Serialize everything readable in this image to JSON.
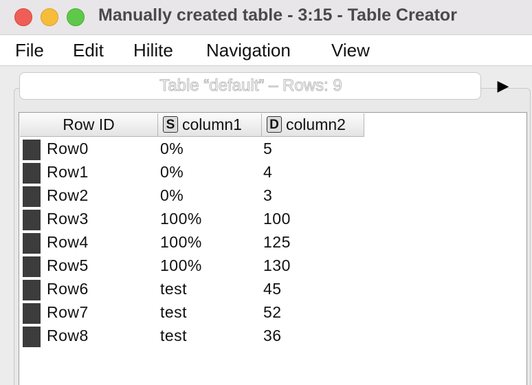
{
  "window": {
    "title": "Manually created table - 3:15 - Table Creator"
  },
  "menu": {
    "items": [
      "File",
      "Edit",
      "Hilite",
      "Navigation",
      "View"
    ]
  },
  "infobar": {
    "text": "Table “default” – Rows: 9",
    "play_icon": "▶"
  },
  "table": {
    "columns": [
      {
        "label": "Row ID",
        "type_badge": ""
      },
      {
        "label": "column1",
        "type_badge": "S"
      },
      {
        "label": "column2",
        "type_badge": "D"
      }
    ],
    "rows": [
      {
        "id": "Row0",
        "c1": "0%",
        "c2": "5"
      },
      {
        "id": "Row1",
        "c1": "0%",
        "c2": "4"
      },
      {
        "id": "Row2",
        "c1": "0%",
        "c2": "3"
      },
      {
        "id": "Row3",
        "c1": "100%",
        "c2": "100"
      },
      {
        "id": "Row4",
        "c1": "100%",
        "c2": "125"
      },
      {
        "id": "Row5",
        "c1": "100%",
        "c2": "130"
      },
      {
        "id": "Row6",
        "c1": "test",
        "c2": "45"
      },
      {
        "id": "Row7",
        "c1": "test",
        "c2": "52"
      },
      {
        "id": "Row8",
        "c1": "test",
        "c2": "36"
      }
    ]
  }
}
